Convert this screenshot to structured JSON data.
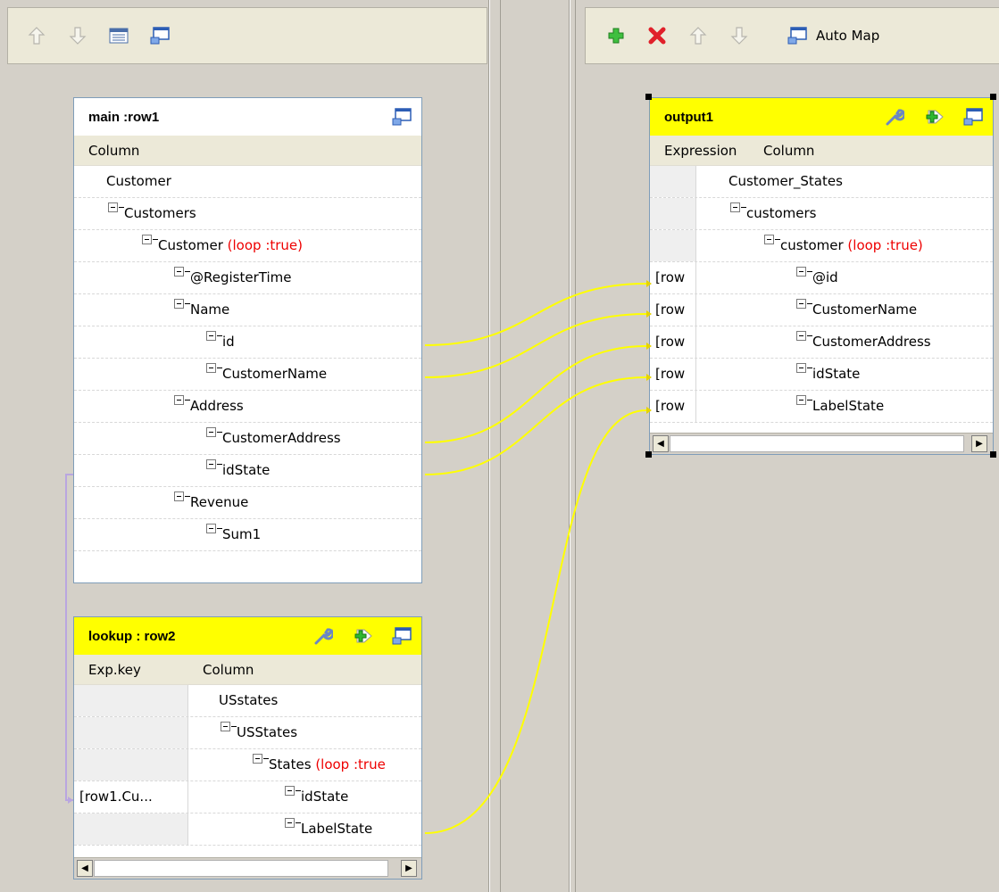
{
  "left_toolbar": {
    "icons": [
      "arrow-up-icon",
      "arrow-down-icon",
      "table-view-icon",
      "minimize-window-icon"
    ]
  },
  "right_toolbar": {
    "icons": [
      "add-icon",
      "delete-icon",
      "arrow-up-icon",
      "arrow-down-icon"
    ],
    "automap_label": "Auto Map"
  },
  "main_table": {
    "title": "main :row1",
    "column_header": "Column",
    "rows": [
      {
        "label": "Customer",
        "loop": ""
      },
      {
        "label": "Customers",
        "loop": ""
      },
      {
        "label": "Customer",
        "loop": "(loop :true)"
      },
      {
        "label": "@RegisterTime",
        "loop": ""
      },
      {
        "label": "Name",
        "loop": ""
      },
      {
        "label": "id",
        "loop": ""
      },
      {
        "label": "CustomerName",
        "loop": ""
      },
      {
        "label": "Address",
        "loop": ""
      },
      {
        "label": "CustomerAddress",
        "loop": ""
      },
      {
        "label": "idState",
        "loop": ""
      },
      {
        "label": "Revenue",
        "loop": ""
      },
      {
        "label": "Sum1",
        "loop": ""
      }
    ]
  },
  "lookup_table": {
    "title": "lookup : row2",
    "col_expkey": "Exp.key",
    "col_column": "Column",
    "rows": [
      {
        "label": "USstates",
        "loop": "",
        "exp": ""
      },
      {
        "label": "USStates",
        "loop": "",
        "exp": ""
      },
      {
        "label": "States",
        "loop": "(loop :true",
        "exp": ""
      },
      {
        "label": "idState",
        "loop": "",
        "exp": "[row1.Cu..."
      },
      {
        "label": "LabelState",
        "loop": "",
        "exp": ""
      }
    ]
  },
  "output_table": {
    "title": "output1",
    "col_expression": "Expression",
    "col_column": "Column",
    "rows": [
      {
        "label": "Customer_States",
        "loop": "",
        "exp": ""
      },
      {
        "label": "customers",
        "loop": "",
        "exp": ""
      },
      {
        "label": "customer",
        "loop": "(loop :true)",
        "exp": ""
      },
      {
        "label": "@id",
        "loop": "",
        "exp": "[row"
      },
      {
        "label": "CustomerName",
        "loop": "",
        "exp": "[row"
      },
      {
        "label": "CustomerAddress",
        "loop": "",
        "exp": "[row"
      },
      {
        "label": "idState",
        "loop": "",
        "exp": "[row"
      },
      {
        "label": "LabelState",
        "loop": "",
        "exp": "[row"
      }
    ]
  },
  "colors": {
    "header_yellow": "#ffff00",
    "link_yellow": "#ffff00",
    "loop_red": "#ee0000",
    "lookup_link": "#b9a6e0"
  }
}
